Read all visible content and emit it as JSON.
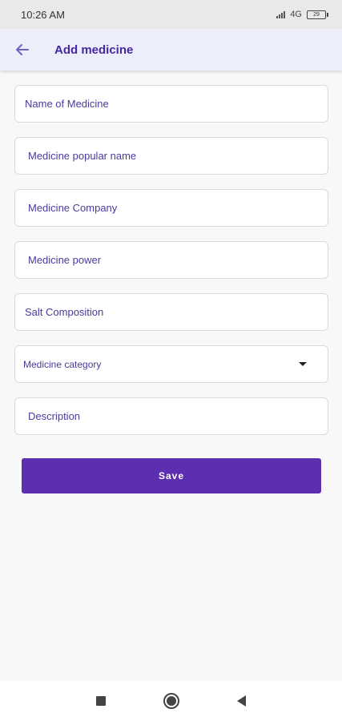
{
  "status_bar": {
    "time": "10:26 AM",
    "network": "4G",
    "battery": "29"
  },
  "app_bar": {
    "title": "Add medicine",
    "back_icon": "arrow-left-icon"
  },
  "form": {
    "fields": [
      {
        "placeholder": "Name of Medicine"
      },
      {
        "placeholder": "Medicine popular name"
      },
      {
        "placeholder": "Medicine Company"
      },
      {
        "placeholder": "Medicine power"
      },
      {
        "placeholder": "Salt Composition"
      },
      {
        "placeholder": "Medicine category",
        "type": "dropdown"
      },
      {
        "placeholder": "Description"
      }
    ],
    "save_label": "Save"
  },
  "colors": {
    "accent": "#5b2fb0",
    "title": "#4527a0",
    "app_bar_bg": "#eceef9"
  },
  "nav_bar": {
    "icons": [
      "recent-apps-icon",
      "home-icon",
      "back-icon"
    ]
  }
}
